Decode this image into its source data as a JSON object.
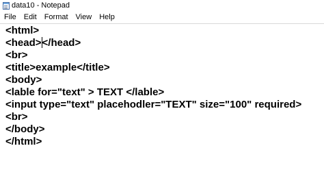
{
  "window": {
    "title": "data10 - Notepad",
    "icon": "notepad-icon"
  },
  "menubar": {
    "items": [
      "File",
      "Edit",
      "Format",
      "View",
      "Help"
    ]
  },
  "editor": {
    "lines": [
      "<html>",
      "<head>",
      "</head>",
      "<br>",
      "<title>example</title>",
      "<body>",
      "<lable for=\"text\" > TEXT </lable>",
      "<input type=\"text\" placehodler=\"TEXT\" size=\"100\" required>",
      "<br>",
      "</body>",
      "</html>"
    ],
    "caret_after_line": 2
  }
}
